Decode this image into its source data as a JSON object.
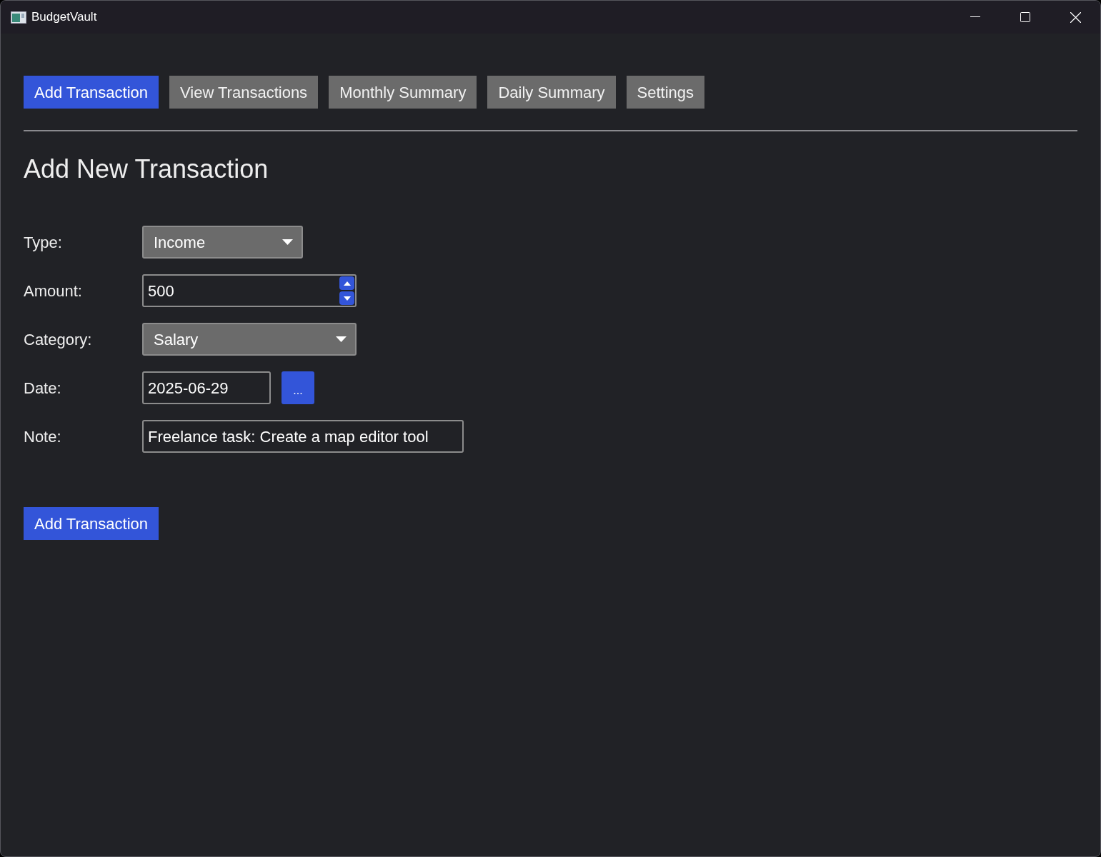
{
  "window": {
    "title": "BudgetVault"
  },
  "tabs": [
    {
      "label": "Add Transaction",
      "selected": true
    },
    {
      "label": "View Transactions",
      "selected": false
    },
    {
      "label": "Monthly Summary",
      "selected": false
    },
    {
      "label": "Daily Summary",
      "selected": false
    },
    {
      "label": "Settings",
      "selected": false
    }
  ],
  "heading": "Add New Transaction",
  "fields": [
    {
      "label": "Type:",
      "kind": "dropdown",
      "value": "Income"
    },
    {
      "label": "Amount:",
      "kind": "spin",
      "value": "500"
    },
    {
      "label": "Category:",
      "kind": "dropdown",
      "value": "Salary",
      "wide": true
    },
    {
      "label": "Date:",
      "kind": "date",
      "value": "2025-06-29",
      "button": "..."
    },
    {
      "label": "Note:",
      "kind": "text",
      "value": "Freelance task: Create a map editor tool"
    }
  ],
  "submit": "Add Transaction"
}
